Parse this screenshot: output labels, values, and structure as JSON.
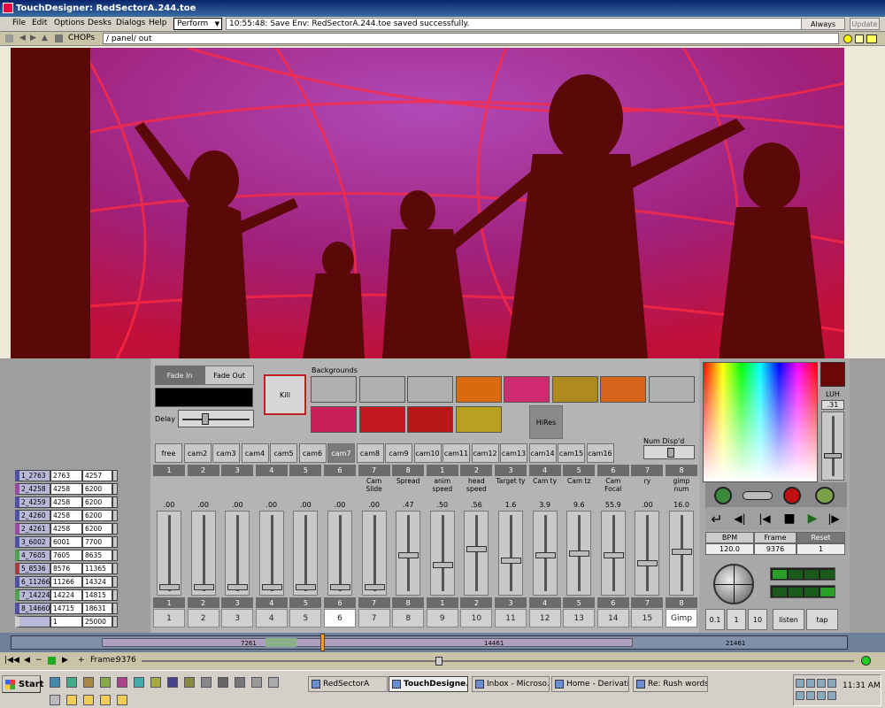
{
  "window": {
    "title": "TouchDesigner: RedSectorA.244.toe"
  },
  "menu": [
    "File",
    "Edit",
    "Options",
    "Desks",
    "Dialogs",
    "Help"
  ],
  "perform_mode": "Perform",
  "status_message": "10:55:48: Save Env: RedSectorA.244.toe saved successfully.",
  "always_label": "Always",
  "update_label": "Update",
  "pathbar": {
    "family": "CHOPs",
    "path": "/ panel/ out"
  },
  "controls": {
    "fade_in": "Fade In",
    "fade_out": "Fade Out",
    "kill": "Kill",
    "backgrounds_label": "Backgrounds",
    "delay_label": "Delay",
    "hires": "HiRes",
    "num_disp_label": "Num Disp'd"
  },
  "background_colors": [
    "#b0b0b0",
    "#b0b0b0",
    "#b0b0b0",
    "#d86a10",
    "#d02a70",
    "#b08a20",
    "#d4641a",
    "#b0b0b0",
    "#c81e5a",
    "#c0181e",
    "#b81818",
    "#b8a020"
  ],
  "cams": [
    "free",
    "cam2",
    "cam3",
    "cam4",
    "cam5",
    "cam6",
    "cam7",
    "cam8",
    "cam9",
    "cam10",
    "cam11",
    "cam12",
    "cam13",
    "cam14",
    "cam15",
    "cam16"
  ],
  "selected_cam": "cam7",
  "channels": [
    {
      "num": "1",
      "label": "",
      "value": ".00",
      "level": 0.0,
      "thumb": "1"
    },
    {
      "num": "2",
      "label": "",
      "value": ".00",
      "level": 0.0,
      "thumb": "2"
    },
    {
      "num": "3",
      "label": "",
      "value": ".00",
      "level": 0.0,
      "thumb": "3"
    },
    {
      "num": "4",
      "label": "",
      "value": ".00",
      "level": 0.0,
      "thumb": "4"
    },
    {
      "num": "5",
      "label": "",
      "value": ".00",
      "level": 0.0,
      "thumb": "5"
    },
    {
      "num": "6",
      "label": "",
      "value": ".00",
      "level": 0.0,
      "thumb": "6"
    },
    {
      "num": "7",
      "label": "Cam Slide",
      "value": ".00",
      "level": 0.0,
      "thumb": "7"
    },
    {
      "num": "8",
      "label": "Spread",
      "value": ".47",
      "level": 0.47,
      "thumb": "8"
    },
    {
      "num": "1",
      "label": "anim speed",
      "value": ".50",
      "level": 0.33,
      "thumb": "9"
    },
    {
      "num": "2",
      "label": "head speed",
      "value": ".56",
      "level": 0.56,
      "thumb": "10"
    },
    {
      "num": "3",
      "label": "Target ty",
      "value": "1.6",
      "level": 0.4,
      "thumb": "11"
    },
    {
      "num": "4",
      "label": "Cam ty",
      "value": "3.9",
      "level": 0.48,
      "thumb": "12"
    },
    {
      "num": "5",
      "label": "Cam tz",
      "value": "9.6",
      "level": 0.5,
      "thumb": "13"
    },
    {
      "num": "6",
      "label": "Cam Focal",
      "value": "55.9",
      "level": 0.48,
      "thumb": "14"
    },
    {
      "num": "7",
      "label": "ry",
      "value": ".00",
      "level": 0.36,
      "thumb": "15"
    },
    {
      "num": "8",
      "label": "gimp num",
      "value": "16.0",
      "level": 0.52,
      "thumb": "Gimp"
    }
  ],
  "table": [
    [
      "1_2763",
      "2763",
      "4257"
    ],
    [
      "2_4258",
      "4258",
      "6200"
    ],
    [
      "2_4259",
      "4258",
      "6200"
    ],
    [
      "2_4260",
      "4258",
      "6200"
    ],
    [
      "2_4261",
      "4258",
      "6200"
    ],
    [
      "3_6002",
      "6001",
      "7700"
    ],
    [
      "4_7605",
      "7605",
      "8635"
    ],
    [
      "5_8536",
      "8576",
      "11365"
    ],
    [
      "6_11266",
      "11266",
      "14324"
    ],
    [
      "7_14224",
      "14224",
      "14815"
    ],
    [
      "8_14660",
      "14715",
      "18631"
    ],
    [
      "",
      "1",
      "25000"
    ]
  ],
  "color_panel": {
    "mode": "LUH",
    "value": ".31"
  },
  "transport": {
    "bpm_label": "BPM",
    "frame_label": "Frame",
    "reset_label": "Reset",
    "bpm": "120.0",
    "frame": "9376",
    "reset": "1"
  },
  "tempo_buttons": [
    "0.1",
    "1",
    "10",
    "listen",
    "tap"
  ],
  "timeline": {
    "markers": [
      "7261",
      "14461",
      "21461"
    ]
  },
  "frame_bar": {
    "label": "Frame:",
    "value": "9376"
  },
  "taskbar": {
    "start": "Start",
    "tasks": [
      "RedSectorA",
      "TouchDesigne...",
      "Inbox - Microso...",
      "Home - Derivati...",
      "Re: Rush words..."
    ],
    "active_task": "TouchDesigne...",
    "clock": "11:31 AM"
  }
}
